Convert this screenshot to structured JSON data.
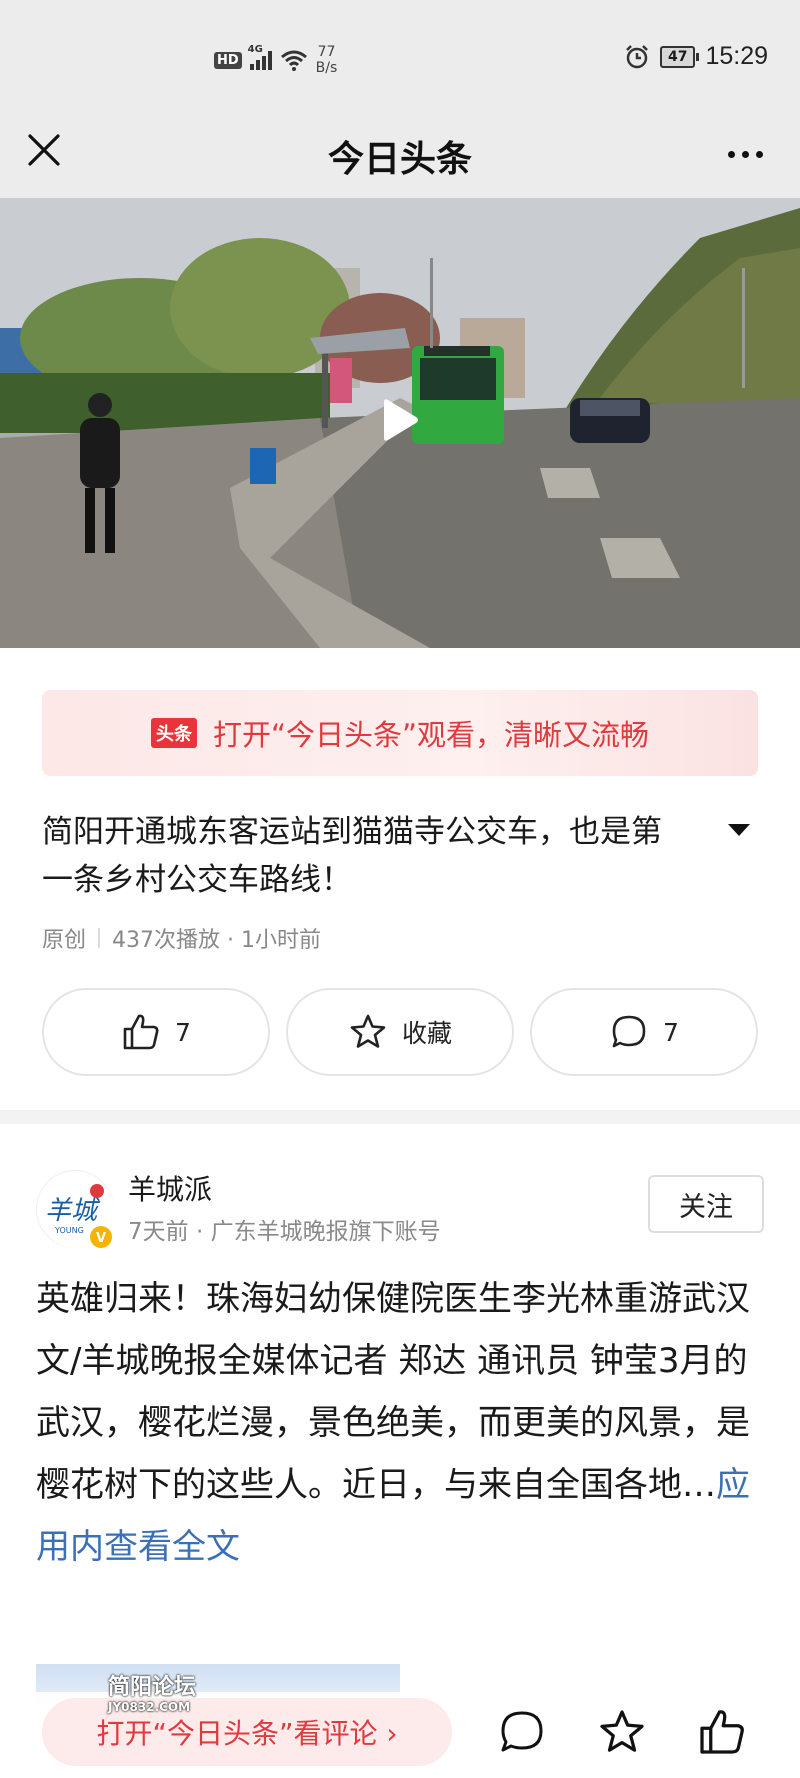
{
  "status_bar": {
    "hd": "HD",
    "signal_label": "4G",
    "net_speed_value": "77",
    "net_speed_unit": "B/s",
    "battery": "47",
    "time": "15:29"
  },
  "titlebar": {
    "title": "今日头条",
    "close_icon": "close-icon",
    "more_icon": "more-dots-icon"
  },
  "video": {
    "play_icon": "play-icon"
  },
  "open_banner": {
    "logo_text": "头条",
    "text": "打开“今日头条”观看，清晰又流畅"
  },
  "article": {
    "title": "简阳开通城东客运站到猫猫寺公交车，也是第一条乡村公交车路线！",
    "original": "原创",
    "plays_time": "437次播放 · 1小时前",
    "likes": "7",
    "favorite_label": "收藏",
    "comments": "7"
  },
  "recommend": {
    "author_name": "羊城派",
    "author_sub": "7天前 · 广东羊城晚报旗下账号",
    "follow_label": "关注",
    "body": "英雄归来！珠海妇幼保健院医生李光林重游武汉　文/羊城晚报全媒体记者 郑达 通讯员 钟莹3月的武汉，樱花烂漫，景色绝美，而更美的风景，是樱花树下的这些人。近日，与来自全国各地…",
    "read_more": "应用内查看全文"
  },
  "bottom_bar": {
    "comment_cta": "打开“今日头条”看评论 ›",
    "watermark_title": "简阳论坛",
    "watermark_url": "JY0832.COM"
  },
  "colors": {
    "brand_red": "#e0393e",
    "link_blue": "#3b6fb6"
  }
}
